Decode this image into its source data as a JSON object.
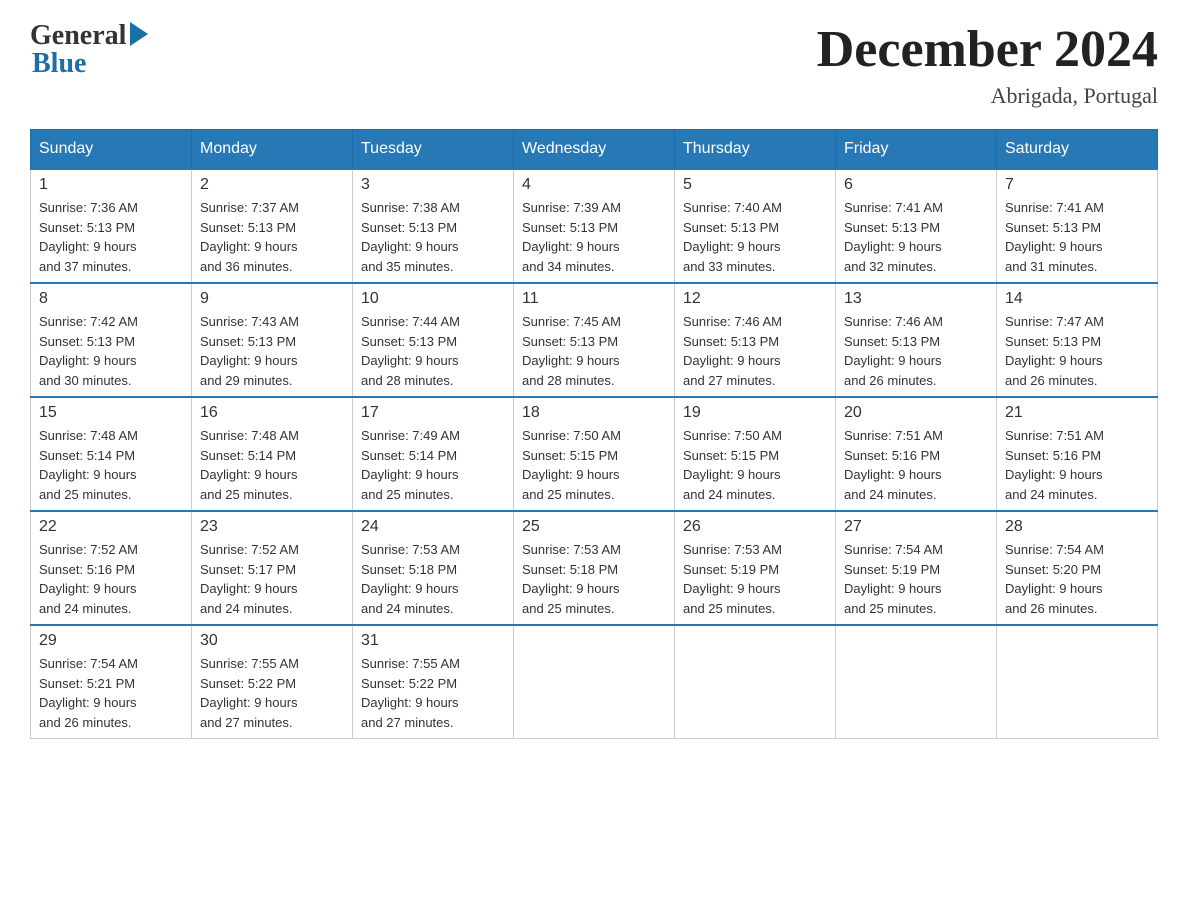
{
  "logo": {
    "general": "General",
    "blue": "Blue"
  },
  "title": {
    "month": "December 2024",
    "location": "Abrigada, Portugal"
  },
  "headers": [
    "Sunday",
    "Monday",
    "Tuesday",
    "Wednesday",
    "Thursday",
    "Friday",
    "Saturday"
  ],
  "weeks": [
    [
      {
        "day": "1",
        "sunrise": "7:36 AM",
        "sunset": "5:13 PM",
        "daylight": "9 hours and 37 minutes."
      },
      {
        "day": "2",
        "sunrise": "7:37 AM",
        "sunset": "5:13 PM",
        "daylight": "9 hours and 36 minutes."
      },
      {
        "day": "3",
        "sunrise": "7:38 AM",
        "sunset": "5:13 PM",
        "daylight": "9 hours and 35 minutes."
      },
      {
        "day": "4",
        "sunrise": "7:39 AM",
        "sunset": "5:13 PM",
        "daylight": "9 hours and 34 minutes."
      },
      {
        "day": "5",
        "sunrise": "7:40 AM",
        "sunset": "5:13 PM",
        "daylight": "9 hours and 33 minutes."
      },
      {
        "day": "6",
        "sunrise": "7:41 AM",
        "sunset": "5:13 PM",
        "daylight": "9 hours and 32 minutes."
      },
      {
        "day": "7",
        "sunrise": "7:41 AM",
        "sunset": "5:13 PM",
        "daylight": "9 hours and 31 minutes."
      }
    ],
    [
      {
        "day": "8",
        "sunrise": "7:42 AM",
        "sunset": "5:13 PM",
        "daylight": "9 hours and 30 minutes."
      },
      {
        "day": "9",
        "sunrise": "7:43 AM",
        "sunset": "5:13 PM",
        "daylight": "9 hours and 29 minutes."
      },
      {
        "day": "10",
        "sunrise": "7:44 AM",
        "sunset": "5:13 PM",
        "daylight": "9 hours and 28 minutes."
      },
      {
        "day": "11",
        "sunrise": "7:45 AM",
        "sunset": "5:13 PM",
        "daylight": "9 hours and 28 minutes."
      },
      {
        "day": "12",
        "sunrise": "7:46 AM",
        "sunset": "5:13 PM",
        "daylight": "9 hours and 27 minutes."
      },
      {
        "day": "13",
        "sunrise": "7:46 AM",
        "sunset": "5:13 PM",
        "daylight": "9 hours and 26 minutes."
      },
      {
        "day": "14",
        "sunrise": "7:47 AM",
        "sunset": "5:13 PM",
        "daylight": "9 hours and 26 minutes."
      }
    ],
    [
      {
        "day": "15",
        "sunrise": "7:48 AM",
        "sunset": "5:14 PM",
        "daylight": "9 hours and 25 minutes."
      },
      {
        "day": "16",
        "sunrise": "7:48 AM",
        "sunset": "5:14 PM",
        "daylight": "9 hours and 25 minutes."
      },
      {
        "day": "17",
        "sunrise": "7:49 AM",
        "sunset": "5:14 PM",
        "daylight": "9 hours and 25 minutes."
      },
      {
        "day": "18",
        "sunrise": "7:50 AM",
        "sunset": "5:15 PM",
        "daylight": "9 hours and 25 minutes."
      },
      {
        "day": "19",
        "sunrise": "7:50 AM",
        "sunset": "5:15 PM",
        "daylight": "9 hours and 24 minutes."
      },
      {
        "day": "20",
        "sunrise": "7:51 AM",
        "sunset": "5:16 PM",
        "daylight": "9 hours and 24 minutes."
      },
      {
        "day": "21",
        "sunrise": "7:51 AM",
        "sunset": "5:16 PM",
        "daylight": "9 hours and 24 minutes."
      }
    ],
    [
      {
        "day": "22",
        "sunrise": "7:52 AM",
        "sunset": "5:16 PM",
        "daylight": "9 hours and 24 minutes."
      },
      {
        "day": "23",
        "sunrise": "7:52 AM",
        "sunset": "5:17 PM",
        "daylight": "9 hours and 24 minutes."
      },
      {
        "day": "24",
        "sunrise": "7:53 AM",
        "sunset": "5:18 PM",
        "daylight": "9 hours and 24 minutes."
      },
      {
        "day": "25",
        "sunrise": "7:53 AM",
        "sunset": "5:18 PM",
        "daylight": "9 hours and 25 minutes."
      },
      {
        "day": "26",
        "sunrise": "7:53 AM",
        "sunset": "5:19 PM",
        "daylight": "9 hours and 25 minutes."
      },
      {
        "day": "27",
        "sunrise": "7:54 AM",
        "sunset": "5:19 PM",
        "daylight": "9 hours and 25 minutes."
      },
      {
        "day": "28",
        "sunrise": "7:54 AM",
        "sunset": "5:20 PM",
        "daylight": "9 hours and 26 minutes."
      }
    ],
    [
      {
        "day": "29",
        "sunrise": "7:54 AM",
        "sunset": "5:21 PM",
        "daylight": "9 hours and 26 minutes."
      },
      {
        "day": "30",
        "sunrise": "7:55 AM",
        "sunset": "5:22 PM",
        "daylight": "9 hours and 27 minutes."
      },
      {
        "day": "31",
        "sunrise": "7:55 AM",
        "sunset": "5:22 PM",
        "daylight": "9 hours and 27 minutes."
      },
      null,
      null,
      null,
      null
    ]
  ],
  "labels": {
    "sunrise": "Sunrise:",
    "sunset": "Sunset:",
    "daylight": "Daylight:"
  }
}
